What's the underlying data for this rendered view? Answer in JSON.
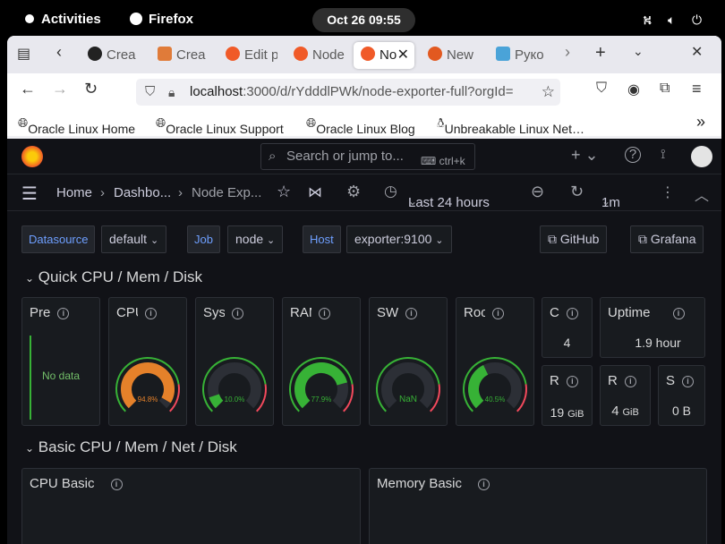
{
  "system": {
    "activities": "Activities",
    "app": "Firefox",
    "clock": "Oct 26  09:55"
  },
  "tabs": [
    {
      "label": "Crea",
      "color": "#222"
    },
    {
      "label": "Crea",
      "color": "#e07b39"
    },
    {
      "label": "Edit p",
      "color": "#f05a28"
    },
    {
      "label": "Node",
      "color": "#f05a28"
    },
    {
      "label": "No",
      "color": "#f05a28"
    },
    {
      "label": "New",
      "color": "#e25920"
    },
    {
      "label": "Руко",
      "color": "#4aa3d8"
    }
  ],
  "url": {
    "host": "localhost",
    "path": ":3000/d/rYdddlPWk/node-exporter-full?orgId="
  },
  "bookmarks": [
    "Oracle Linux Home",
    "Oracle Linux Support",
    "Oracle Linux Blog",
    "Unbreakable Linux Net…"
  ],
  "grafana": {
    "search_placeholder": "Search or jump to...",
    "search_kbd": "ctrl+k",
    "breadcrumb": [
      "Home",
      "Dashbo...",
      "Node Exp..."
    ],
    "time_range": "Last 24 hours",
    "refresh": "1m",
    "vars": [
      {
        "label": "Datasource",
        "value": "default"
      },
      {
        "label": "Job",
        "value": "node"
      },
      {
        "label": "Host",
        "value": "exporter:9100"
      }
    ],
    "links": [
      "GitHub",
      "Grafana"
    ],
    "row1": "Quick CPU / Mem / Disk",
    "row2": "Basic CPU / Mem / Net / Disk",
    "panels": {
      "pre": {
        "title": "Pre",
        "value": "No data"
      },
      "cpu": {
        "title": "CPU",
        "value": "94.8%",
        "level": 0.948,
        "color": "#e5812a"
      },
      "sys": {
        "title": "Sys",
        "value": "10.0%",
        "level": 0.1,
        "color": "#37b236"
      },
      "ram": {
        "title": "RAM",
        "value": "77.9%",
        "level": 0.779,
        "color": "#37b236"
      },
      "sw": {
        "title": "SW",
        "value": "NaN",
        "level": 0,
        "color": "#37b236"
      },
      "roo": {
        "title": "Roo",
        "value": "40.5%",
        "level": 0.405,
        "color": "#37b236"
      },
      "cores": {
        "title": "C",
        "value": "4"
      },
      "uptime": {
        "title": "Uptime",
        "value": "1.9 hour"
      },
      "r1": {
        "title": "R",
        "value": "19",
        "unit": "GiB"
      },
      "r2": {
        "title": "R",
        "value": "4",
        "unit": "GiB"
      },
      "s": {
        "title": "S",
        "value": "0 B"
      },
      "cpubasic": {
        "title": "CPU Basic"
      },
      "membasic": {
        "title": "Memory Basic"
      }
    }
  }
}
